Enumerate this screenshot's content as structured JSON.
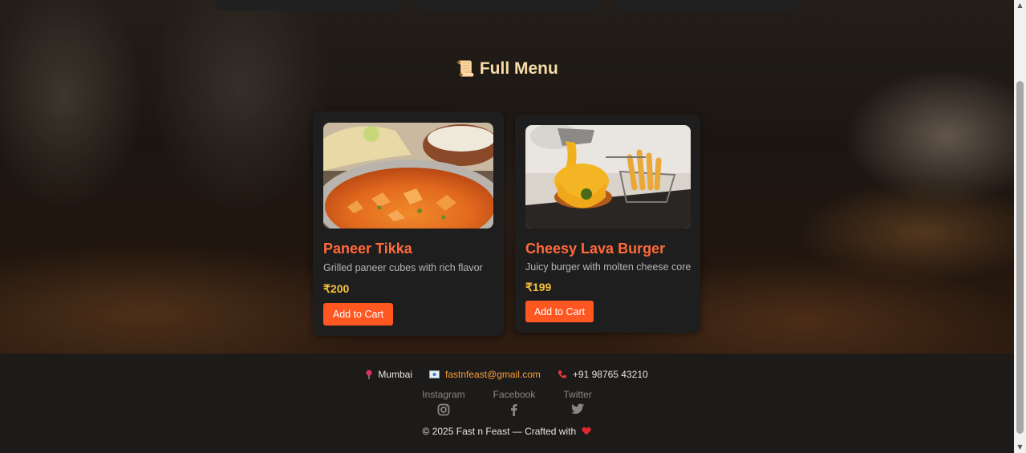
{
  "menu": {
    "title": "Full Menu",
    "title_icon": "scroll-icon",
    "items": [
      {
        "name": "Paneer Tikka",
        "description": "Grilled paneer cubes with rich flavor",
        "price": "₹200",
        "button_label": "Add to Cart",
        "image": "paneer-tikka-photo"
      },
      {
        "name": "Cheesy Lava Burger",
        "description": "Juicy burger with molten cheese core",
        "price": "₹199",
        "button_label": "Add to Cart",
        "image": "cheesy-lava-burger-photo"
      }
    ]
  },
  "footer": {
    "location": "Mumbai",
    "email": "fastnfeast@gmail.com",
    "phone": "+91 98765 43210",
    "socials": [
      {
        "label": "Instagram",
        "icon": "instagram-icon"
      },
      {
        "label": "Facebook",
        "icon": "facebook-icon"
      },
      {
        "label": "Twitter",
        "icon": "twitter-icon"
      }
    ],
    "copyright": "© 2025 Fast n Feast — Crafted with"
  },
  "colors": {
    "accent": "#ff5722",
    "title": "#f7dca8",
    "price": "#f7c23a",
    "card": "#1f1e1e",
    "footer": "#1d1a1a"
  }
}
